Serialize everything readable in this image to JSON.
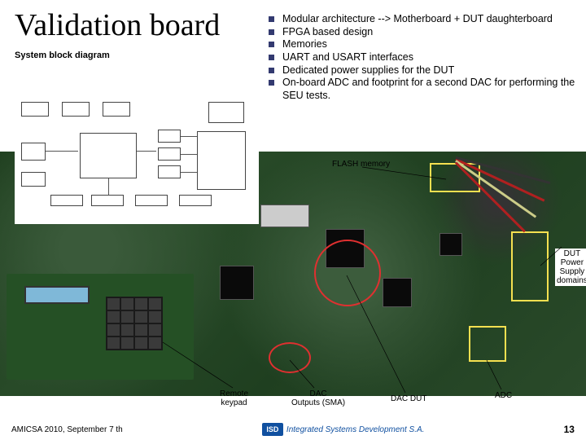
{
  "title": "Validation board",
  "subtitle": "System block diagram",
  "bullets": [
    "Modular architecture --> Motherboard + DUT daughterboard",
    "FPGA based design",
    "Memories",
    "UART and USART interfaces",
    "Dedicated power supplies for the DUT",
    "On-board ADC and footprint for a second DAC for performing the SEU tests."
  ],
  "annotations": {
    "flash": "FLASH memory",
    "dut_power": "DUT\nPower\nSupply\ndomains",
    "remote_keypad": "Remote\nkeypad",
    "dac_outputs": "DAC\nOutputs (SMA)",
    "dac_dut": "DAC DUT",
    "adc": "ADC"
  },
  "footer": {
    "left": "AMICSA 2010, September 7 th",
    "logo_line1": "ISD",
    "logo_line2": "Integrated Systems Development S.A.",
    "page": "13"
  }
}
